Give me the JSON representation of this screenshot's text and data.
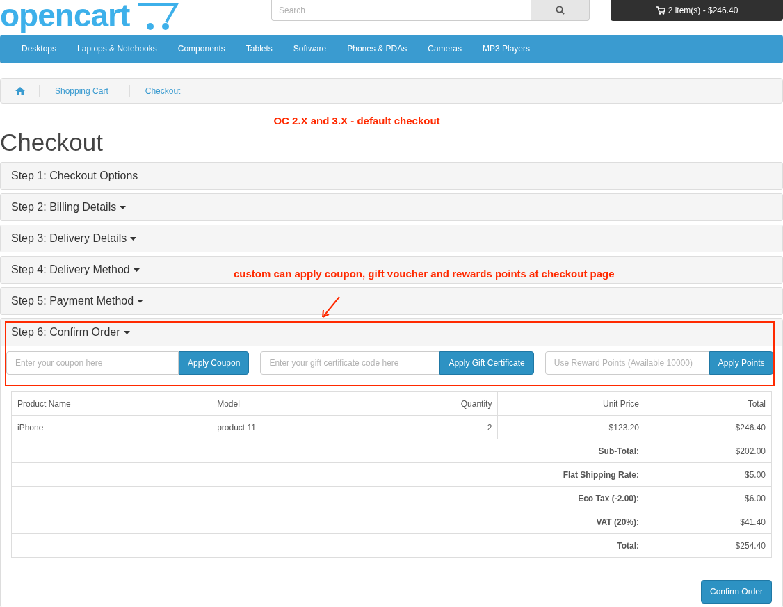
{
  "logo": {
    "text": "opencart"
  },
  "search": {
    "placeholder": "Search"
  },
  "cart_button": {
    "label": "2 item(s) - $246.40"
  },
  "nav": [
    "Desktops",
    "Laptops & Notebooks",
    "Components",
    "Tablets",
    "Software",
    "Phones & PDAs",
    "Cameras",
    "MP3 Players"
  ],
  "breadcrumb": [
    "Shopping Cart",
    "Checkout"
  ],
  "annotations": [
    "OC 2.X and 3.X - default checkout",
    "custom can apply coupon, gift voucher and rewards points at checkout page"
  ],
  "heading": "Checkout",
  "steps": [
    {
      "label": "Step 1: Checkout Options",
      "expanded": false,
      "caret": false
    },
    {
      "label": "Step 2: Billing Details",
      "expanded": false,
      "caret": true
    },
    {
      "label": "Step 3: Delivery Details",
      "expanded": false,
      "caret": true
    },
    {
      "label": "Step 4: Delivery Method",
      "expanded": false,
      "caret": true
    },
    {
      "label": "Step 5: Payment Method",
      "expanded": false,
      "caret": true
    },
    {
      "label": "Step 6: Confirm Order",
      "expanded": true,
      "caret": true
    }
  ],
  "discounts": [
    {
      "placeholder": "Enter your coupon here",
      "button": "Apply Coupon"
    },
    {
      "placeholder": "Enter your gift certificate code here",
      "button": "Apply Gift Certificate"
    },
    {
      "placeholder": "Use Reward Points (Available 10000)",
      "button": "Apply Points"
    }
  ],
  "table": {
    "columns": [
      "Product Name",
      "Model",
      "Quantity",
      "Unit Price",
      "Total"
    ],
    "rows": [
      {
        "product": "iPhone",
        "model": "product 11",
        "quantity": "2",
        "unit_price": "$123.20",
        "total": "$246.40"
      }
    ],
    "totals": [
      {
        "label": "Sub-Total:",
        "value": "$202.00"
      },
      {
        "label": "Flat Shipping Rate:",
        "value": "$5.00"
      },
      {
        "label": "Eco Tax (-2.00):",
        "value": "$6.00"
      },
      {
        "label": "VAT (20%):",
        "value": "$41.40"
      },
      {
        "label": "Total:",
        "value": "$254.40"
      }
    ]
  },
  "confirm_button": "Confirm Order"
}
